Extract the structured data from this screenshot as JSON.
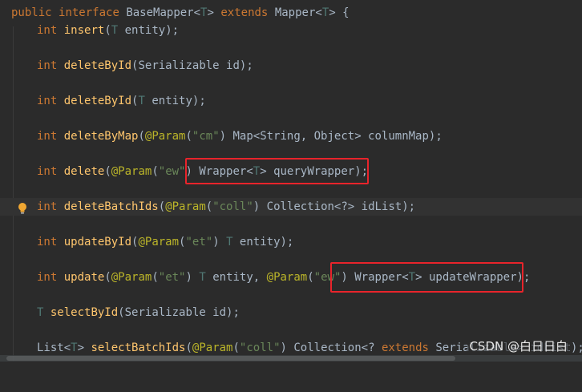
{
  "lines": {
    "l0": [
      "public",
      " ",
      "interface",
      " ",
      "BaseMapper",
      "<",
      "T",
      ">",
      " ",
      "extends",
      " ",
      "Mapper",
      "<",
      "T",
      "> {"
    ],
    "l1": [
      "int",
      " ",
      "insert",
      "(",
      "T",
      " entity);"
    ],
    "l2": [
      "int",
      " ",
      "deleteById",
      "(Serializable id);"
    ],
    "l3": [
      "int",
      " ",
      "deleteById",
      "(",
      "T",
      " entity);"
    ],
    "l4": [
      "int",
      " ",
      "deleteByMap",
      "(",
      "@Param",
      "(",
      "\"cm\"",
      ") Map<String, Object> columnMap);"
    ],
    "l5": [
      "int",
      " ",
      "delete",
      "(",
      "@Param",
      "(",
      "\"ew\"",
      ") ",
      "Wrapper<",
      "T",
      "> queryWrapper);"
    ],
    "l6": [
      "int",
      " ",
      "deleteBatchIds",
      "(",
      "@Param",
      "(",
      "\"coll\"",
      ") Collection<?> idList);"
    ],
    "l7": [
      "int",
      " ",
      "updateById",
      "(",
      "@Param",
      "(",
      "\"et\"",
      ") ",
      "T",
      " entity);"
    ],
    "l8": [
      "int",
      " ",
      "update",
      "(",
      "@Param",
      "(",
      "\"et\"",
      ") ",
      "T",
      " entity, ",
      "@Param",
      "(",
      "\"ew\"",
      ") ",
      "Wrapper<",
      "T",
      "> updateWrapper);"
    ],
    "l9": [
      "T",
      " ",
      "selectById",
      "(Serializable id);"
    ],
    "l10": [
      "List<",
      "T",
      "> ",
      "selectBatchIds",
      "(",
      "@Param",
      "(",
      "\"coll\"",
      ") Collection<? ",
      "extends",
      " Serializable> idList);"
    ]
  },
  "watermark": "CSDN @白日日白",
  "icons": {
    "intention": "lightbulb-icon"
  },
  "colors": {
    "background": "#2b2b2b",
    "keyword": "#cc7832",
    "type_param": "#507874",
    "method": "#ffc66d",
    "annotation": "#bbb529",
    "string": "#6a8759",
    "highlight_box": "#e8242b"
  }
}
